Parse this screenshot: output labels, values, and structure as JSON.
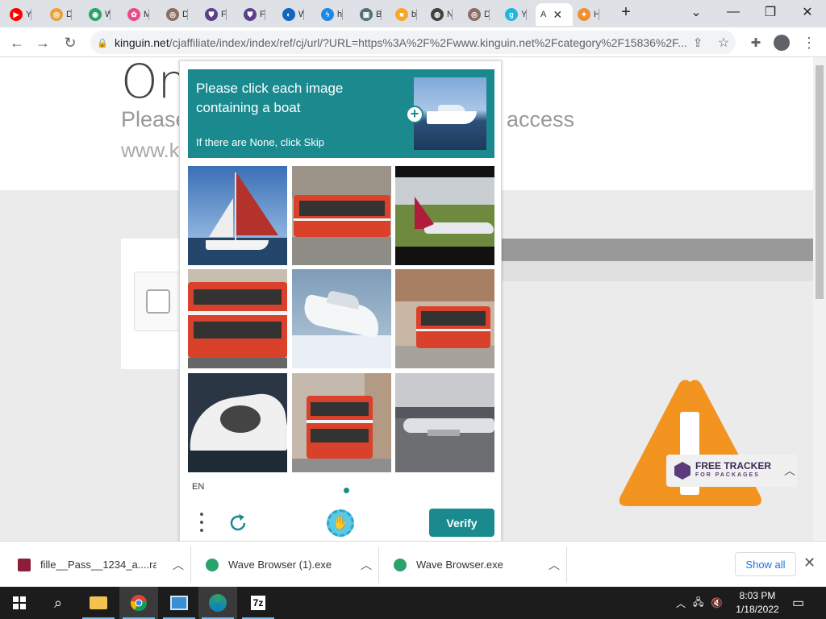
{
  "browser": {
    "tabs": [
      {
        "label": "Y",
        "color": "#ff0000",
        "glyph": "▶"
      },
      {
        "label": "D",
        "color": "#e8a33c",
        "glyph": "◎"
      },
      {
        "label": "W",
        "color": "#2aa36b",
        "glyph": "◉"
      },
      {
        "label": "M",
        "color": "#e94b8a",
        "glyph": "✿"
      },
      {
        "label": "D",
        "color": "#8d6e63",
        "glyph": "◎"
      },
      {
        "label": "F",
        "color": "#5b3f8c",
        "glyph": "⛊"
      },
      {
        "label": "F",
        "color": "#5b3f8c",
        "glyph": "⛊"
      },
      {
        "label": "W",
        "color": "#1565c0",
        "glyph": "◐"
      },
      {
        "label": "h",
        "color": "#1e88e5",
        "glyph": "ϟ"
      },
      {
        "label": "B",
        "color": "#546e7a",
        "glyph": "▣"
      },
      {
        "label": "b",
        "color": "#f9a825",
        "glyph": "■"
      },
      {
        "label": "N",
        "color": "#424242",
        "glyph": "◍"
      },
      {
        "label": "D",
        "color": "#8d6e63",
        "glyph": "◎"
      },
      {
        "label": "Y",
        "color": "#1db7e0",
        "glyph": "g"
      },
      {
        "label": "A",
        "color": "#ffffff",
        "glyph": ""
      },
      {
        "label": "H",
        "color": "#ef8f2f",
        "glyph": "✦"
      }
    ],
    "new_tab": "+",
    "url_host": "kinguin.net",
    "url_rest": "/cjaffiliate/index/index/ref/cj/url/?URL=https%3A%2F%2Fwww.kinguin.net%2Fcategory%2F15836%2F..."
  },
  "page": {
    "title": "On",
    "subtitle_left": "Please",
    "subtitle_right": "access",
    "subtitle2": "www.k"
  },
  "captcha": {
    "prompt": "Please click each image containing a boat",
    "skip_hint": "If there are None, click Skip",
    "language": "EN",
    "verify_label": "Verify",
    "tiles": [
      "sailboat",
      "bus",
      "airplane",
      "bus",
      "boat",
      "bus",
      "boat",
      "bus",
      "airplane"
    ]
  },
  "ad": {
    "name": "FREE TRACKER",
    "tagline": "FOR PACKAGES"
  },
  "downloads": {
    "items": [
      {
        "name": "fille__Pass__1234_a....rar",
        "icon": "rar-icon",
        "color": "#8b1f3a"
      },
      {
        "name": "Wave Browser (1).exe",
        "icon": "wave-icon",
        "color": "#2aa36b"
      },
      {
        "name": "Wave Browser.exe",
        "icon": "wave-icon",
        "color": "#2aa36b"
      }
    ],
    "show_all": "Show all"
  },
  "taskbar": {
    "time": "8:03 PM",
    "date": "1/18/2022",
    "app_7z": "7z"
  }
}
